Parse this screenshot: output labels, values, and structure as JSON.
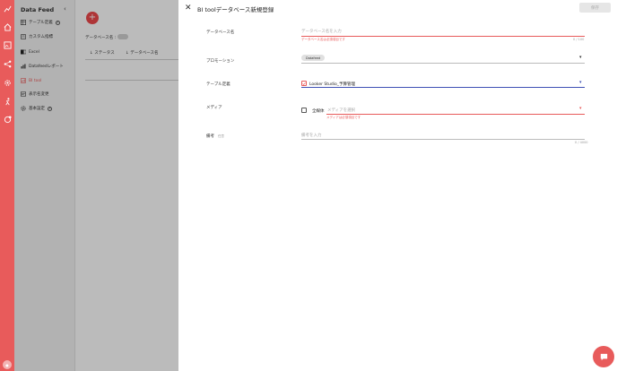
{
  "sidebar": {
    "title": "Data Feed",
    "items": [
      {
        "label": "テーブル定義",
        "icon": "table-icon"
      },
      {
        "label": "カスタム指標",
        "icon": "calculator-icon"
      },
      {
        "label": "Excel",
        "icon": "excel-icon"
      },
      {
        "label": "Datafeedレポート",
        "icon": "report-icon"
      },
      {
        "label": "BI tool",
        "icon": "bi-tool-icon"
      },
      {
        "label": "表示名変更",
        "icon": "rename-icon"
      },
      {
        "label": "基本設定",
        "icon": "gear-icon"
      }
    ]
  },
  "main": {
    "db_name_label": "データベース名 :",
    "columns": [
      "ステータス",
      "データベース名"
    ]
  },
  "dialog": {
    "title": "BI toolデータベース新規登録",
    "save_label": "保存",
    "fields": {
      "db_name": {
        "label": "データベース名",
        "placeholder": "データベース名を入力",
        "error": "データベース名は必須項目です",
        "counter": "0 / 100"
      },
      "promotion": {
        "label": "プロモーション",
        "value": "Datafeed"
      },
      "table_def": {
        "label": "テーブル定義",
        "value": "Looker Studio_予算管理"
      },
      "media": {
        "label": "メディア",
        "all_label": "全媒体",
        "placeholder": "メディアを選択",
        "error": "メディアは必須項目です"
      },
      "note": {
        "label": "備考",
        "optional": "任意",
        "placeholder": "備考を入力",
        "counter": "0 / 4000"
      }
    }
  },
  "colors": {
    "accent": "#e85b5b",
    "focus": "#3f51b5"
  }
}
